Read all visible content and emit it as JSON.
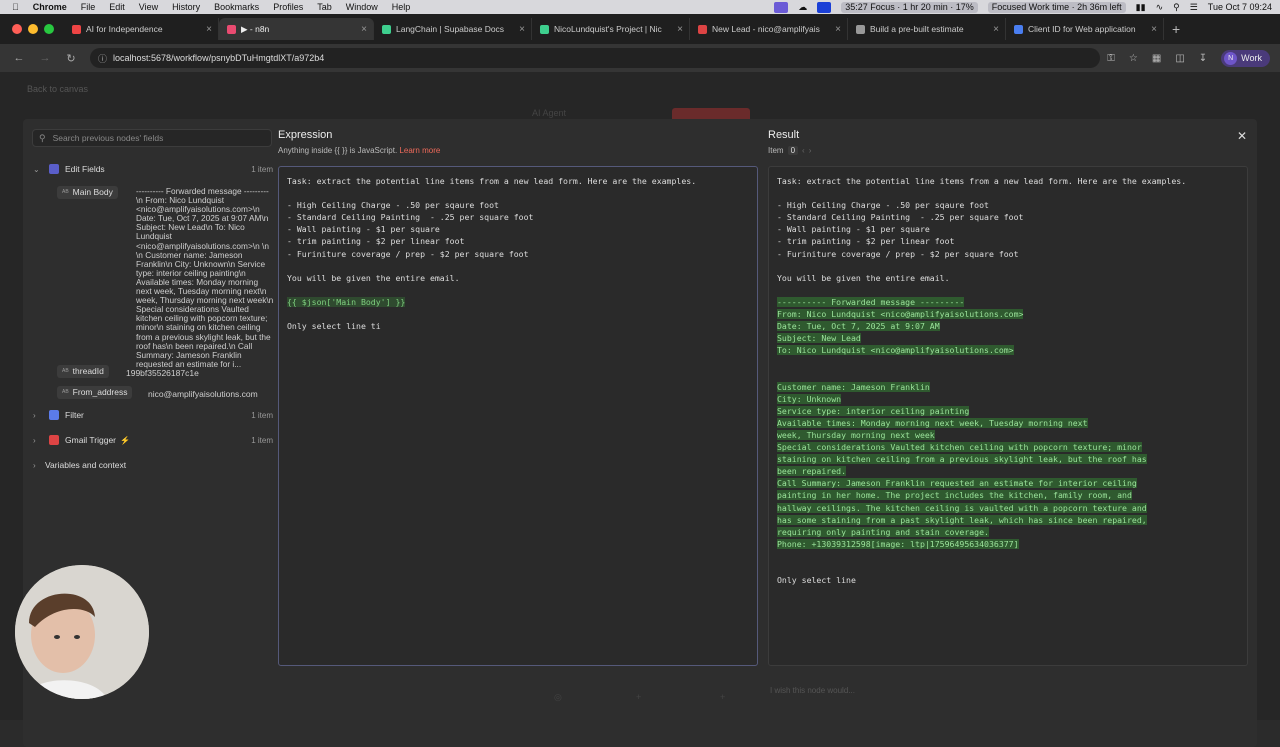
{
  "menubar": {
    "app": "Chrome",
    "items": [
      "File",
      "Edit",
      "View",
      "History",
      "Bookmarks",
      "Profiles",
      "Tab",
      "Window",
      "Help"
    ],
    "focus_timer": "35:27 Focus · 1 hr 20 min · 17%",
    "focused_work": "Focused Work time · 2h 36m left",
    "clock": "Tue Oct 7  09:24"
  },
  "tabs": [
    {
      "label": "AI for Independence",
      "color": "#e44"
    },
    {
      "label": "▶ - n8n",
      "color": "#ea4b71",
      "active": true
    },
    {
      "label": "LangChain | Supabase Docs",
      "color": "#3ecf8e"
    },
    {
      "label": "NicoLundquist's Project | Nic",
      "color": "#3ecf8e"
    },
    {
      "label": "New Lead - nico@amplifyais",
      "color": "#d44"
    },
    {
      "label": "Build a pre-built estimate",
      "color": "#999"
    },
    {
      "label": "Client ID for Web application",
      "color": "#4a7ef0"
    }
  ],
  "address": {
    "url": "localhost:5678/workflow/psnybDTuHmgtdlXT/a972b4",
    "profile": "Work",
    "profile_initial": "N"
  },
  "canvas": {
    "back_label": "Back to canvas",
    "ghost_node": "AI Agent",
    "bottom_hint": "I wish this node would..."
  },
  "sidebar": {
    "search_placeholder": "Search previous nodes' fields",
    "nodes": [
      {
        "name": "Edit Fields",
        "count": "1 item"
      },
      {
        "name": "Filter",
        "count": "1 item"
      },
      {
        "name": "Gmail Trigger",
        "count": "1 item"
      },
      {
        "name": "Variables and context",
        "count": ""
      }
    ],
    "fields": [
      {
        "key": "Main Body",
        "value": "---------- Forwarded message ---------\\n From: Nico Lundquist <nico@amplifyaisolutions.com>\\n Date: Tue, Oct 7, 2025 at 9:07 AM\\n Subject: New Lead\\n To: Nico Lundquist <nico@amplifyaisolutions.com>\\n \\n \\n Customer name: Jameson Franklin\\n City: Unknown\\n Service type: interior ceiling painting\\n Available times: Monday morning next week, Tuesday morning next\\n week, Thursday morning next week\\n Special considerations Vaulted kitchen ceiling with popcorn texture; minor\\n staining on kitchen ceiling from a previous skylight leak, but the roof has\\n been repaired.\\n Call Summary: Jameson Franklin requested an estimate for i..."
      },
      {
        "key": "threadId",
        "value": "199bf35526187c1e"
      },
      {
        "key": "From_address",
        "value": "nico@amplifyaisolutions.com"
      }
    ]
  },
  "expression": {
    "title": "Expression",
    "subtitle": "Anything inside {{ }} is JavaScript.",
    "learn_more": "Learn more",
    "lines": [
      "Task: extract the potential line items from a new lead form. Here are the examples.",
      "",
      "- High Ceiling Charge - .50 per sqaure foot",
      "- Standard Ceiling Painting  - .25 per square foot",
      "- Wall painting - $1 per square",
      "- trim painting - $2 per linear foot",
      "- Furiniture coverage / prep - $2 per square foot",
      "",
      "You will be given the entire email.",
      ""
    ],
    "expr_token": "{{ $json['Main Body'] }}",
    "last_line": "Only select line ti"
  },
  "result": {
    "title": "Result",
    "item_label": "Item",
    "item_index": "0",
    "lines": [
      "Task: extract the potential line items from a new lead form. Here are the examples.",
      "",
      "- High Ceiling Charge - .50 per sqaure foot",
      "- Standard Ceiling Painting  - .25 per square foot",
      "- Wall painting - $1 per square",
      "- trim painting - $2 per linear foot",
      "- Furiniture coverage / prep - $2 per square foot",
      "",
      "You will be given the entire email.",
      ""
    ],
    "highlight_lines": [
      "---------- Forwarded message ---------",
      "From: Nico Lundquist <nico@amplifyaisolutions.com>",
      "Date: Tue, Oct 7, 2025 at 9:07 AM",
      "Subject: New Lead",
      "To: Nico Lundquist <nico@amplifyaisolutions.com>",
      "",
      "",
      "Customer name: Jameson Franklin",
      "City: Unknown",
      "Service type: interior ceiling painting",
      "Available times: Monday morning next week, Tuesday morning next",
      "week, Thursday morning next week",
      "Special considerations Vaulted kitchen ceiling with popcorn texture; minor",
      "staining on kitchen ceiling from a previous skylight leak, but the roof has",
      "been repaired.",
      "Call Summary: Jameson Franklin requested an estimate for interior ceiling",
      "painting in her home. The project includes the kitchen, family room, and",
      "hallway ceilings. The kitchen ceiling is vaulted with a popcorn texture and",
      "has some staining from a past skylight leak, which has since been repaired,",
      "requiring only painting and stain coverage.",
      "Phone: +13039312598[image: ltp|17596495634036377]"
    ],
    "last_line": "Only select line"
  }
}
